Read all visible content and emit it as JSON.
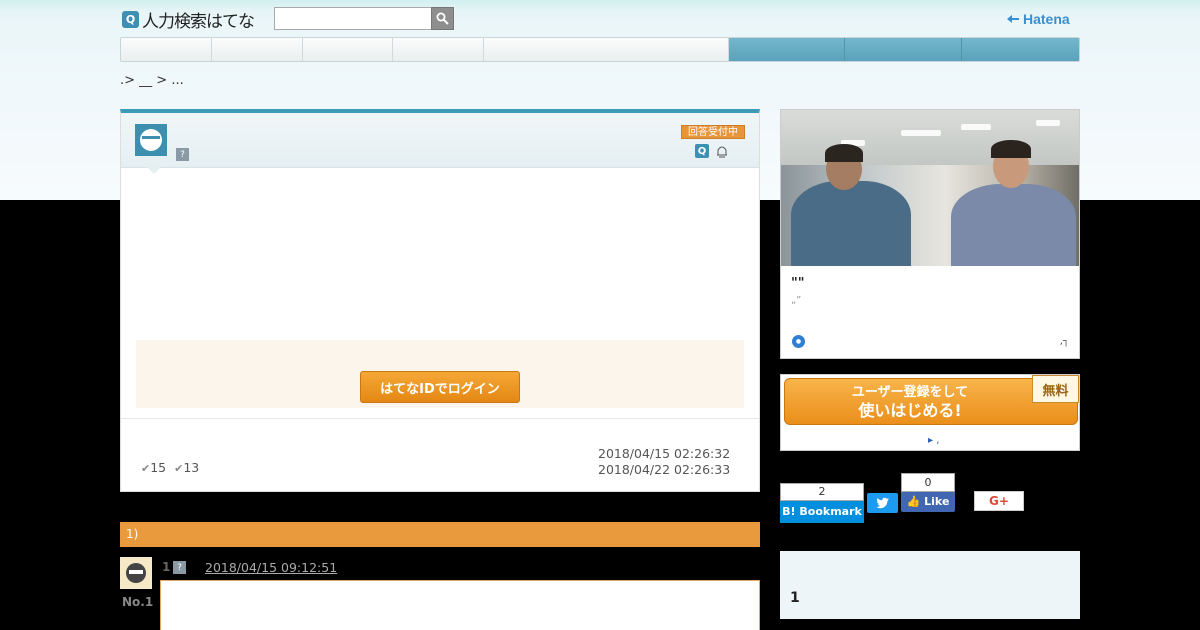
{
  "header": {
    "logo_icon": "Q",
    "logo_text": "人力検索はてな",
    "search": {
      "value": "",
      "placeholder": ""
    },
    "search_icon": "search-icon",
    "brand_text": "Hatena"
  },
  "breadcrumb": ".> __ > ...",
  "question": {
    "status_badge": "回答受付中",
    "counts": {
      "a": "15",
      "b": "13"
    },
    "dates": {
      "posted": "2018/04/15 02:26:32",
      "deadline": "2018/04/22 02:26:33"
    },
    "login_button": "はてなIDでログイン"
  },
  "answers": {
    "header": "1)",
    "items": [
      {
        "num": "1",
        "date": "2018/04/15 09:12:51",
        "rank": "No.1"
      }
    ]
  },
  "sidebar": {
    "promo": {
      "title": "\"\"",
      "subtitle": "„”",
      "ext_mark": ",┐"
    },
    "register": {
      "line1": "ユーザー登録をして",
      "line2": "使いはじめる!",
      "free": "無料",
      "link": "▸ ,"
    },
    "social": {
      "hatena_count": "2",
      "hatena_label": "B! Bookmark",
      "fb_count": "0",
      "fb_label": "Like",
      "gplus_label": "G+"
    },
    "box_number": "1"
  },
  "colors": {
    "accent_blue": "#3e9bb8",
    "orange": "#e99a3c",
    "nav_blue": "#5aa2ba"
  }
}
